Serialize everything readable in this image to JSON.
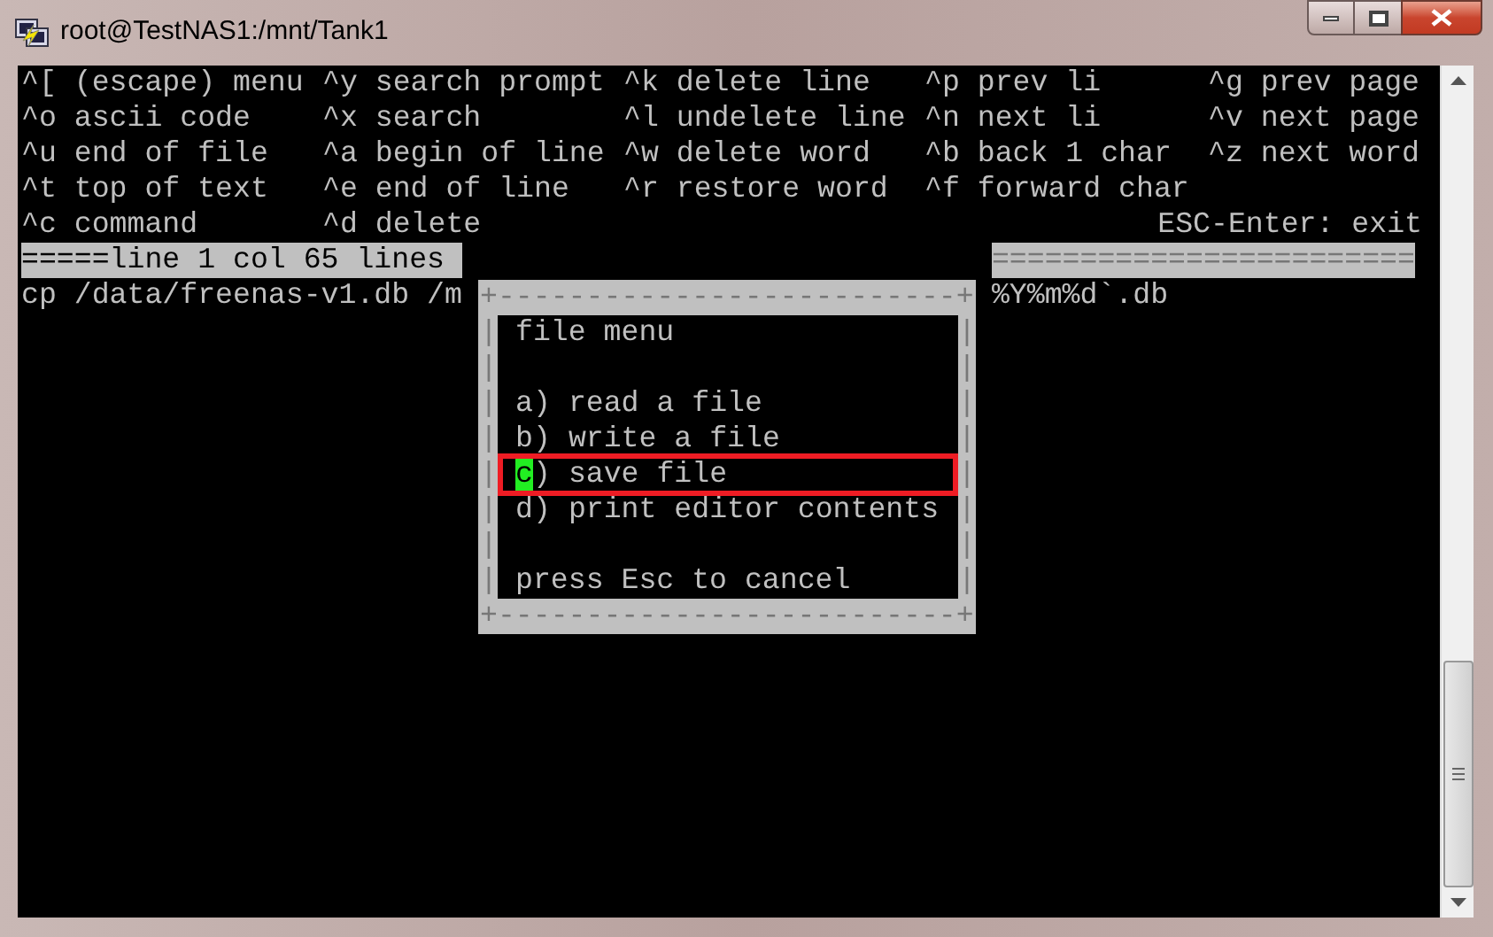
{
  "window": {
    "title": "root@TestNAS1:/mnt/Tank1"
  },
  "help": {
    "rows": [
      [
        "^[ (escape) menu",
        "^y search prompt",
        "^k delete line",
        "^p prev li",
        "^g prev page"
      ],
      [
        "^o ascii code",
        "^x search",
        "^l undelete line",
        "^n next li",
        "^v next page"
      ],
      [
        "^u end of file",
        "^a begin of line",
        "^w delete word",
        "^b back 1 char",
        "^z next word"
      ],
      [
        "^t top of text",
        "^e end of line",
        "^r restore word",
        "^f forward char"
      ],
      [
        "^c command",
        "^d delete"
      ]
    ],
    "exit": "ESC-Enter: exit"
  },
  "status_bar": {
    "left": "=====line 1 col 65 lines ",
    "right": "========================"
  },
  "text_line": {
    "left": "cp /data/freenas-v1.db /m",
    "right": "%Y%m%d`.db"
  },
  "dialog": {
    "border_top": "+--------------------------+",
    "border_bottom": "+--------------------------+",
    "rows": [
      {
        "kind": "title",
        "left": "|",
        "right": "|",
        "text": "file menu"
      },
      {
        "kind": "blank",
        "left": "|",
        "right": "|"
      },
      {
        "kind": "option",
        "left": "|",
        "right": "|",
        "key": "a)",
        "label": "read a file",
        "selected": false
      },
      {
        "kind": "option",
        "left": "|",
        "right": "|",
        "key": "b)",
        "label": "write a file",
        "selected": false
      },
      {
        "kind": "option",
        "left": "|",
        "right": "|",
        "key": "c)",
        "label": "save file",
        "selected": true
      },
      {
        "kind": "option",
        "left": "|",
        "right": "|",
        "key": "d)",
        "label": "print editor contents",
        "selected": false
      },
      {
        "kind": "blank",
        "left": "|",
        "right": "|"
      },
      {
        "kind": "title",
        "left": "|",
        "right": "|",
        "text": "press Esc to cancel"
      }
    ]
  }
}
